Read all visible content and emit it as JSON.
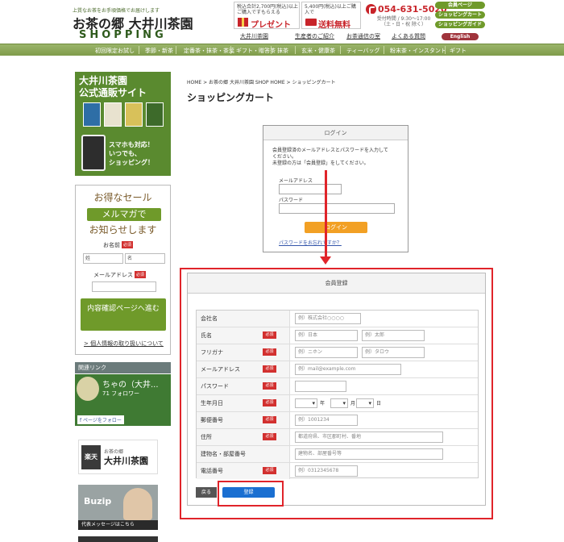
{
  "header": {
    "tagline": "上質なお茶をお手頃価格でお届けします",
    "logo_main": "お茶の郷 大井川茶園",
    "logo_sub": "SHOPPING",
    "promo_present_small": "税込合計2,700円(税込)以上ご購入ですもらえる",
    "promo_present_big": "プレゼント",
    "promo_shipping_small": "5,400円(税込)以上ご購入で",
    "promo_shipping_big": "送料無料",
    "phone": "054-631-5020",
    "phone_hours": "受付時間 / 9:30～17:00（土・日・祝 除く）",
    "pills": [
      "会員ページ",
      "ショッピングカート",
      "ショッピングガイド"
    ],
    "english": "English",
    "links": [
      "大井川茶園",
      "生産者のご紹介",
      "お茶通信の室",
      "よくある質問"
    ]
  },
  "nav": [
    "初回限定お試し",
    "季節・新茶",
    "定番茶・抹茶・茶葉",
    "ギフト・贈答茶",
    "抹茶",
    "玄米・健康茶",
    "ティーバッグ",
    "粉末茶・インスタント",
    "ギフト"
  ],
  "sidebar": {
    "banner_title_1": "大井川茶園",
    "banner_title_2": "公式通販サイト",
    "banner_copy_1": "スマホも対応！",
    "banner_copy_2": "いつでも、",
    "banner_copy_3": "ショッピング！",
    "mail_title_1": "お得なセール",
    "mail_title_2": "メルマガで",
    "mail_title_3": "お知らせします",
    "name_label": "お名前",
    "required": "必須",
    "last_name_placeholder": "姓",
    "first_name_placeholder": "名",
    "email_label": "メールアドレス",
    "confirm_button": "内容確認ページへ進む",
    "privacy_link": "> 個人情報の取り扱いについて",
    "related_links": "関連リンク",
    "chanoen_name": "ちゃの（大井...",
    "chanoen_sub": "71 フォロワー",
    "facebook_follow": "f ページをフォロー",
    "rakuten_logo": "楽天",
    "rakuten_text": "お茶の郷",
    "rakuten_main": "大井川茶園",
    "buzip_logo": "Buzip",
    "buzip_bar": "代表メッセージはこちら"
  },
  "main": {
    "breadcrumb": "HOME > お茶の郷 大井川茶園 SHOP HOME > ショッピングカート",
    "title": "ショッピングカート"
  },
  "login": {
    "head": "ログイン",
    "text_1": "会員登録済のメールアドレスとパスワードを入力して",
    "text_2": "ください。",
    "text_3": "未登録の方は「会員登録」をしてください。",
    "email_label": "メールアドレス",
    "password_label": "パスワード",
    "button": "ログイン",
    "forgot": "パスワードをお忘れですか？"
  },
  "register": {
    "head": "会員登録",
    "required": "必須",
    "rows": [
      {
        "label": "会社名",
        "required": false,
        "placeholder": "例）株式会社○○○○"
      },
      {
        "label": "氏名",
        "required": true,
        "placeholder_1": "例）日本",
        "placeholder_2": "例）太郎"
      },
      {
        "label": "フリガナ",
        "required": true,
        "placeholder_1": "例）ニホン",
        "placeholder_2": "例）タロウ"
      },
      {
        "label": "メールアドレス",
        "required": true,
        "placeholder": "例）mail@example.com"
      },
      {
        "label": "パスワード",
        "required": true,
        "placeholder": ""
      },
      {
        "label": "生年月日",
        "required": true,
        "unit_year": "年",
        "unit_month": "月",
        "unit_day": "日"
      },
      {
        "label": "郵便番号",
        "required": true,
        "placeholder": "例）1001234"
      },
      {
        "label": "住所",
        "required": true,
        "placeholder": "都道府県、市区郡町村、番地"
      },
      {
        "label": "建物名・部屋番号",
        "required": false,
        "placeholder": "建物名、部屋番号等"
      },
      {
        "label": "電話番号",
        "required": true,
        "placeholder": "例）0312345678"
      }
    ],
    "back_button": "戻る",
    "submit_button": "登録"
  },
  "colors": {
    "brand_green": "#6f9a2a",
    "accent_red": "#c8242a",
    "annotation_red": "#e0242a",
    "login_orange": "#f2a024",
    "submit_blue": "#1a6fd1"
  }
}
